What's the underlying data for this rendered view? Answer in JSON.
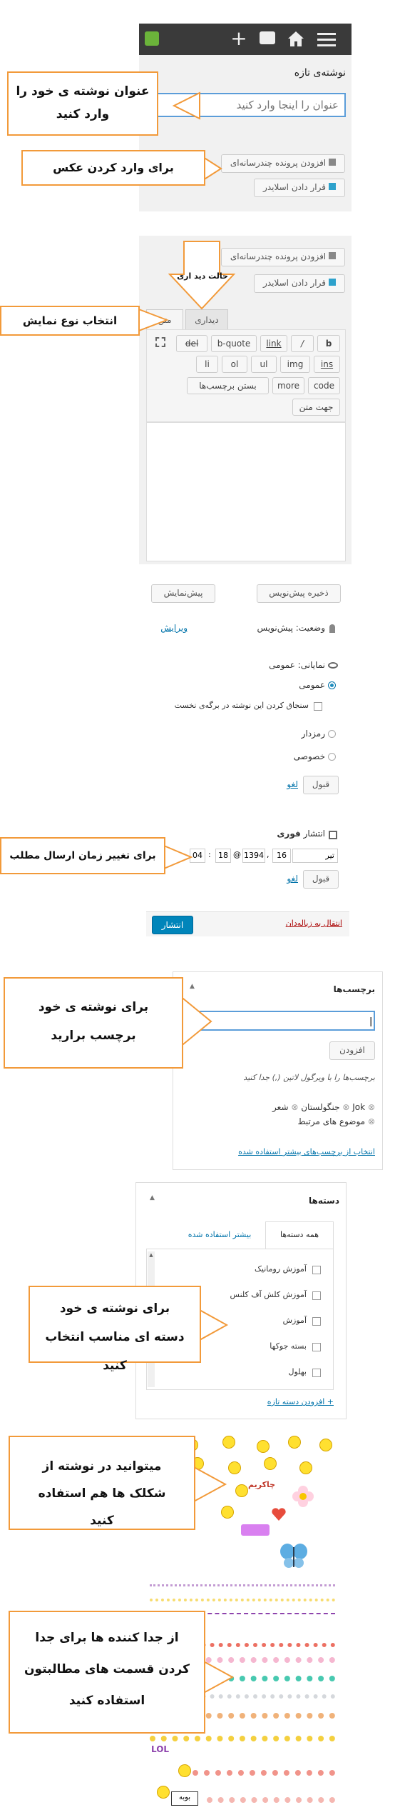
{
  "section1": {
    "page_title": "نوشته‌ی تازه",
    "title_placeholder": "عنوان را اینجا وارد کنید",
    "add_media": "افزودن پرونده چندرسانه‌ای",
    "add_slider": "قرار دادن اسلایدر",
    "callout_title": "عنوان نوشته ی خود را وارد کنید",
    "callout_image": "برای وارد کردن عکس"
  },
  "section2": {
    "add_media": "افزودن پرونده چندرسانه‌ای",
    "add_slider": "قرار دادن اسلایدر",
    "arrow_label": "حالت دید اری",
    "tab_visual": "دیداری",
    "tab_text": "متن",
    "callout_view": "انتخاب نوع نمایش",
    "quicktags": [
      "b",
      "/",
      "link",
      "b-quote",
      "del",
      "ins",
      "img",
      "ul",
      "ol",
      "li",
      "code",
      "more",
      "بستن برچسب‌ها",
      "جهت متن"
    ]
  },
  "publish": {
    "save_draft": "ذخیره پیش‌نویس",
    "preview": "پیش‌نمایش",
    "status_label": "وضعیت: پیش‌نویس",
    "edit_link": "ویرایش",
    "visibility_label": "نمایانی: عمومی",
    "opt_public": "عمومی",
    "opt_sticky": "سنجاق کردن این نوشته در برگه‌ی نخست",
    "opt_password": "رمزدار",
    "opt_private": "خصوصی",
    "ok": "قبول",
    "cancel": "لغو",
    "publish_label": "انتشار",
    "publish_when": "فوری",
    "month": "تیر",
    "day": "16",
    "year": "1394",
    "hour": "18",
    "minute": "04",
    "trash": "انتقال به زباله‌دان",
    "publish_btn": "انتشار",
    "callout_time": "برای تغییر زمان ارسال مطلب"
  },
  "tags": {
    "title": "برچسب‌ها",
    "input_value": "|",
    "add_btn": "افزودن",
    "hint": "برچسب‌ها را با ویرگول لاتین (,) جدا کنید",
    "tag_items": [
      "Jok",
      "جنگولستان",
      "شعر",
      "موضوع های مرتبط"
    ],
    "choose_link": "انتخاب از برچسب‌های بیشتر استفاده شده",
    "callout": "برای نوشته ی خود برچسب برارید"
  },
  "categories": {
    "title": "دسته‌ها",
    "tab_all": "همه دسته‌ها",
    "tab_popular": "بیشتر استفاده شده",
    "items": [
      "آموزش رومانیک",
      "آموزش کلش آف کلنس",
      "آموزش",
      "بسته جوکها",
      "بهلول"
    ],
    "add_link": "+ افزودن دسته تازه",
    "callout": "برای نوشته ی خود دسته ای مناسب انتخاب کنید"
  },
  "stickers": {
    "callout_shapes": "میتوانید در نوشته از شکلک ها هم استفاده کنید",
    "callout_dividers": "از جدا کننده ها برای جدا کردن قسمت های مطالبتون استفاده کنید",
    "chakerim": "چاکریم",
    "lol": "LOL",
    "label_bottom": "بوبه"
  },
  "colors": {
    "toolbar": "#3a3a3a",
    "accent": "#0073aa",
    "orange": "#f29a3a",
    "publish_blue": "#0085ba",
    "trash_red": "#a00"
  }
}
